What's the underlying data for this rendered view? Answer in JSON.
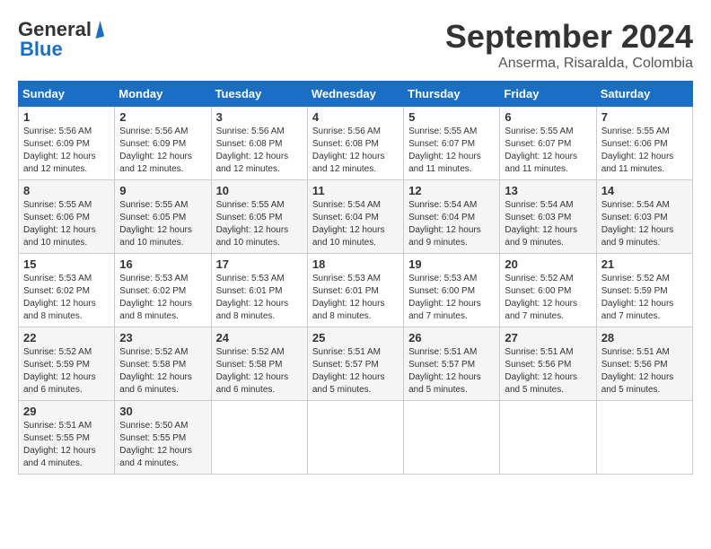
{
  "header": {
    "logo_general": "General",
    "logo_blue": "Blue",
    "month_year": "September 2024",
    "location": "Anserma, Risaralda, Colombia"
  },
  "days_of_week": [
    "Sunday",
    "Monday",
    "Tuesday",
    "Wednesday",
    "Thursday",
    "Friday",
    "Saturday"
  ],
  "weeks": [
    [
      {
        "day": "1",
        "detail": "Sunrise: 5:56 AM\nSunset: 6:09 PM\nDaylight: 12 hours\nand 12 minutes."
      },
      {
        "day": "2",
        "detail": "Sunrise: 5:56 AM\nSunset: 6:09 PM\nDaylight: 12 hours\nand 12 minutes."
      },
      {
        "day": "3",
        "detail": "Sunrise: 5:56 AM\nSunset: 6:08 PM\nDaylight: 12 hours\nand 12 minutes."
      },
      {
        "day": "4",
        "detail": "Sunrise: 5:56 AM\nSunset: 6:08 PM\nDaylight: 12 hours\nand 12 minutes."
      },
      {
        "day": "5",
        "detail": "Sunrise: 5:55 AM\nSunset: 6:07 PM\nDaylight: 12 hours\nand 11 minutes."
      },
      {
        "day": "6",
        "detail": "Sunrise: 5:55 AM\nSunset: 6:07 PM\nDaylight: 12 hours\nand 11 minutes."
      },
      {
        "day": "7",
        "detail": "Sunrise: 5:55 AM\nSunset: 6:06 PM\nDaylight: 12 hours\nand 11 minutes."
      }
    ],
    [
      {
        "day": "8",
        "detail": "Sunrise: 5:55 AM\nSunset: 6:06 PM\nDaylight: 12 hours\nand 10 minutes."
      },
      {
        "day": "9",
        "detail": "Sunrise: 5:55 AM\nSunset: 6:05 PM\nDaylight: 12 hours\nand 10 minutes."
      },
      {
        "day": "10",
        "detail": "Sunrise: 5:55 AM\nSunset: 6:05 PM\nDaylight: 12 hours\nand 10 minutes."
      },
      {
        "day": "11",
        "detail": "Sunrise: 5:54 AM\nSunset: 6:04 PM\nDaylight: 12 hours\nand 10 minutes."
      },
      {
        "day": "12",
        "detail": "Sunrise: 5:54 AM\nSunset: 6:04 PM\nDaylight: 12 hours\nand 9 minutes."
      },
      {
        "day": "13",
        "detail": "Sunrise: 5:54 AM\nSunset: 6:03 PM\nDaylight: 12 hours\nand 9 minutes."
      },
      {
        "day": "14",
        "detail": "Sunrise: 5:54 AM\nSunset: 6:03 PM\nDaylight: 12 hours\nand 9 minutes."
      }
    ],
    [
      {
        "day": "15",
        "detail": "Sunrise: 5:53 AM\nSunset: 6:02 PM\nDaylight: 12 hours\nand 8 minutes."
      },
      {
        "day": "16",
        "detail": "Sunrise: 5:53 AM\nSunset: 6:02 PM\nDaylight: 12 hours\nand 8 minutes."
      },
      {
        "day": "17",
        "detail": "Sunrise: 5:53 AM\nSunset: 6:01 PM\nDaylight: 12 hours\nand 8 minutes."
      },
      {
        "day": "18",
        "detail": "Sunrise: 5:53 AM\nSunset: 6:01 PM\nDaylight: 12 hours\nand 8 minutes."
      },
      {
        "day": "19",
        "detail": "Sunrise: 5:53 AM\nSunset: 6:00 PM\nDaylight: 12 hours\nand 7 minutes."
      },
      {
        "day": "20",
        "detail": "Sunrise: 5:52 AM\nSunset: 6:00 PM\nDaylight: 12 hours\nand 7 minutes."
      },
      {
        "day": "21",
        "detail": "Sunrise: 5:52 AM\nSunset: 5:59 PM\nDaylight: 12 hours\nand 7 minutes."
      }
    ],
    [
      {
        "day": "22",
        "detail": "Sunrise: 5:52 AM\nSunset: 5:59 PM\nDaylight: 12 hours\nand 6 minutes."
      },
      {
        "day": "23",
        "detail": "Sunrise: 5:52 AM\nSunset: 5:58 PM\nDaylight: 12 hours\nand 6 minutes."
      },
      {
        "day": "24",
        "detail": "Sunrise: 5:52 AM\nSunset: 5:58 PM\nDaylight: 12 hours\nand 6 minutes."
      },
      {
        "day": "25",
        "detail": "Sunrise: 5:51 AM\nSunset: 5:57 PM\nDaylight: 12 hours\nand 5 minutes."
      },
      {
        "day": "26",
        "detail": "Sunrise: 5:51 AM\nSunset: 5:57 PM\nDaylight: 12 hours\nand 5 minutes."
      },
      {
        "day": "27",
        "detail": "Sunrise: 5:51 AM\nSunset: 5:56 PM\nDaylight: 12 hours\nand 5 minutes."
      },
      {
        "day": "28",
        "detail": "Sunrise: 5:51 AM\nSunset: 5:56 PM\nDaylight: 12 hours\nand 5 minutes."
      }
    ],
    [
      {
        "day": "29",
        "detail": "Sunrise: 5:51 AM\nSunset: 5:55 PM\nDaylight: 12 hours\nand 4 minutes."
      },
      {
        "day": "30",
        "detail": "Sunrise: 5:50 AM\nSunset: 5:55 PM\nDaylight: 12 hours\nand 4 minutes."
      },
      {
        "day": "",
        "detail": ""
      },
      {
        "day": "",
        "detail": ""
      },
      {
        "day": "",
        "detail": ""
      },
      {
        "day": "",
        "detail": ""
      },
      {
        "day": "",
        "detail": ""
      }
    ]
  ]
}
